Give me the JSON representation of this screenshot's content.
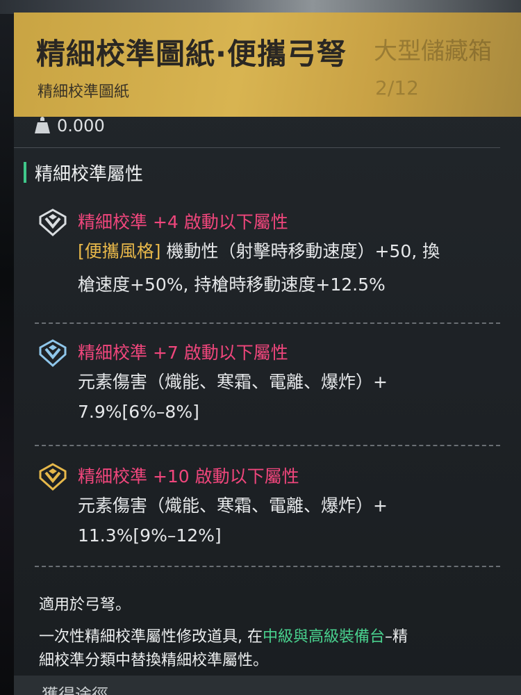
{
  "header": {
    "title": "精細校準圖紙·便攜弓弩",
    "subtitle": "精細校準圖紙",
    "ghost_right_1": "大型儲藏箱",
    "ghost_right_2": "2/12"
  },
  "weight": {
    "icon": "weight-icon",
    "value": "0.000"
  },
  "section": {
    "title": "精細校準屬性"
  },
  "attributes": [
    {
      "icon": "calibration-emblem-silver-icon",
      "heading": "精細校準 +4 啟動以下屬性",
      "tag": "[便攜風格]",
      "line1": "機動性（射擊時移動速度）+50, 換",
      "line2": "槍速度+50%, 持槍時移動速度+12.5%"
    },
    {
      "icon": "calibration-emblem-blue-icon",
      "heading": "精細校準 +7 啟動以下屬性",
      "line1": "元素傷害（熾能、寒霜、電離、爆炸）+",
      "value": "7.9%",
      "range": "[6%–8%]"
    },
    {
      "icon": "calibration-emblem-gold-icon",
      "heading": "精細校準 +10 啟動以下屬性",
      "line1": "元素傷害（熾能、寒霜、電離、爆炸）+",
      "value": "11.3%",
      "range": "[9%–12%]"
    }
  ],
  "footer": {
    "line1": "適用於弓弩。",
    "line2_a": "一次性精細校準屬性修改道具, 在",
    "line2_highlight": "中級與高級裝備台",
    "line2_b": "–精",
    "line3": "細校準分類中替換精細校準屬性。"
  },
  "bottom": {
    "text": "獲得途徑"
  },
  "colors": {
    "header_gold": "#d8b451",
    "attr_pink": "#f0467c",
    "tag_gold": "#e8b84a",
    "highlight_green": "#49d18e",
    "section_bar": "#3fc88a"
  }
}
